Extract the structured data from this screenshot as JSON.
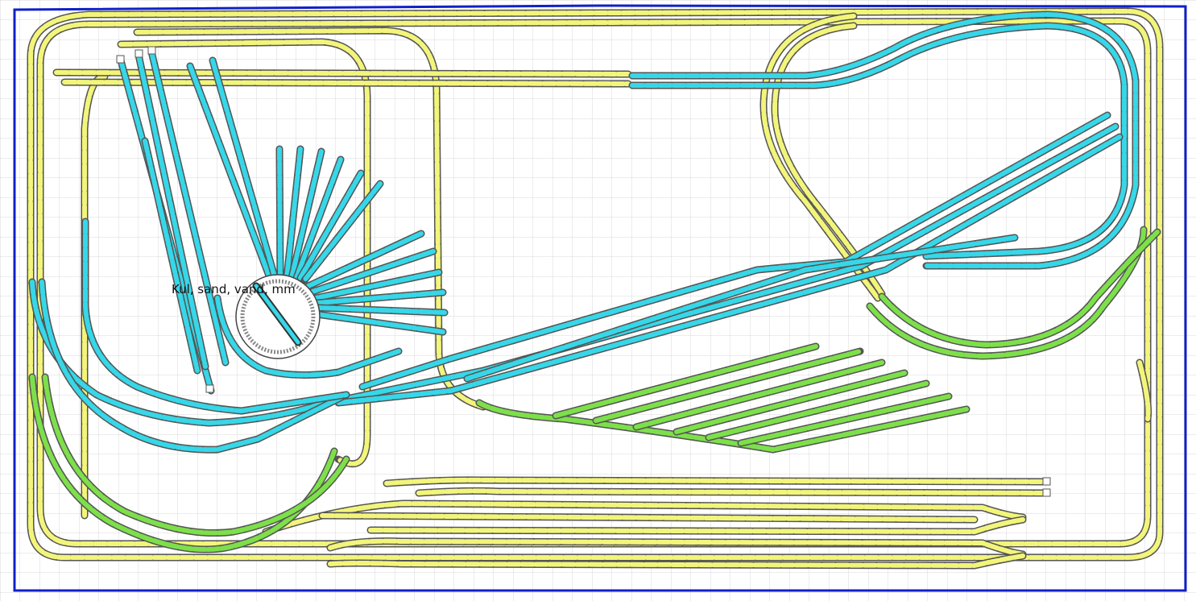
{
  "layout_title": "",
  "colors": {
    "background": "#ffffff",
    "grid": "#d8d8d8",
    "border": "#1020c8",
    "track_outline": "#555555",
    "track_tie": "#b0b0b0",
    "mainline_yellow": "#f2f57a",
    "branch_cyan": "#36d7e8",
    "siding_green": "#7de04a",
    "turntable_pit": "#ffffff"
  },
  "labels": {
    "depot_supplies": "Kul, sand, vand, mm"
  },
  "track_groups": {
    "mainline": "yellow",
    "branch": "cyan",
    "yard": "green"
  }
}
